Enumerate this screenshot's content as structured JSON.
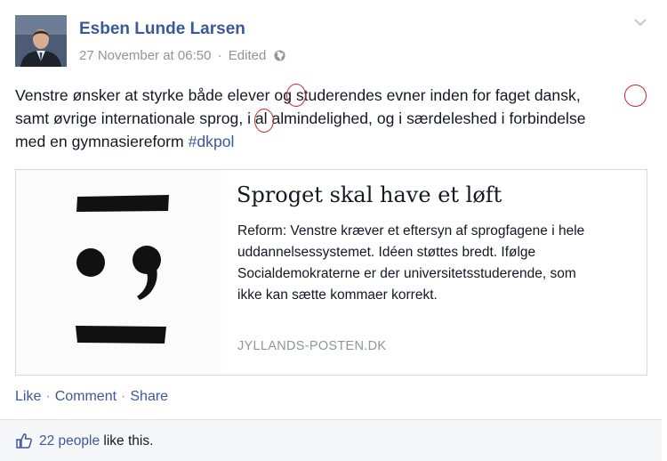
{
  "post": {
    "author": "Esben Lunde Larsen",
    "date": "27 November at 06:50",
    "edited": "Edited",
    "meta_separator": "·",
    "privacy_icon": "globe-icon",
    "menu_icon": "chevron-down-icon",
    "text_lines": [
      "Venstre ønsker at styrke både elever og studerendes evner inden for faget dansk,",
      "samt øvrige internationale sprog, i al almindelighed, og i særdeleshed i forbindelse",
      "med en gymnasiereform "
    ],
    "hashtag": "#dkpol"
  },
  "link_preview": {
    "title": "Sproget skal have et løft",
    "description_lines": [
      "Reform: Venstre kræver et eftersyn af sprogfagene i hele",
      "uddannelsessystemet. Idéen støttes bredt. Ifølge",
      "Socialdemokraterne er der universitetsstuderende, som",
      "ikke kan sætte kommaer korrekt."
    ],
    "source": "JYLLANDS-POSTEN.DK"
  },
  "actions": {
    "like": "Like",
    "comment": "Comment",
    "share": "Share",
    "separator": "·"
  },
  "likes": {
    "icon": "thumbs-up-icon",
    "count_link": "22 people",
    "suffix": " like this."
  },
  "colors": {
    "link_blue": "#3b5998",
    "meta_grey": "#90949c",
    "annotation_red": "#c0292b"
  }
}
